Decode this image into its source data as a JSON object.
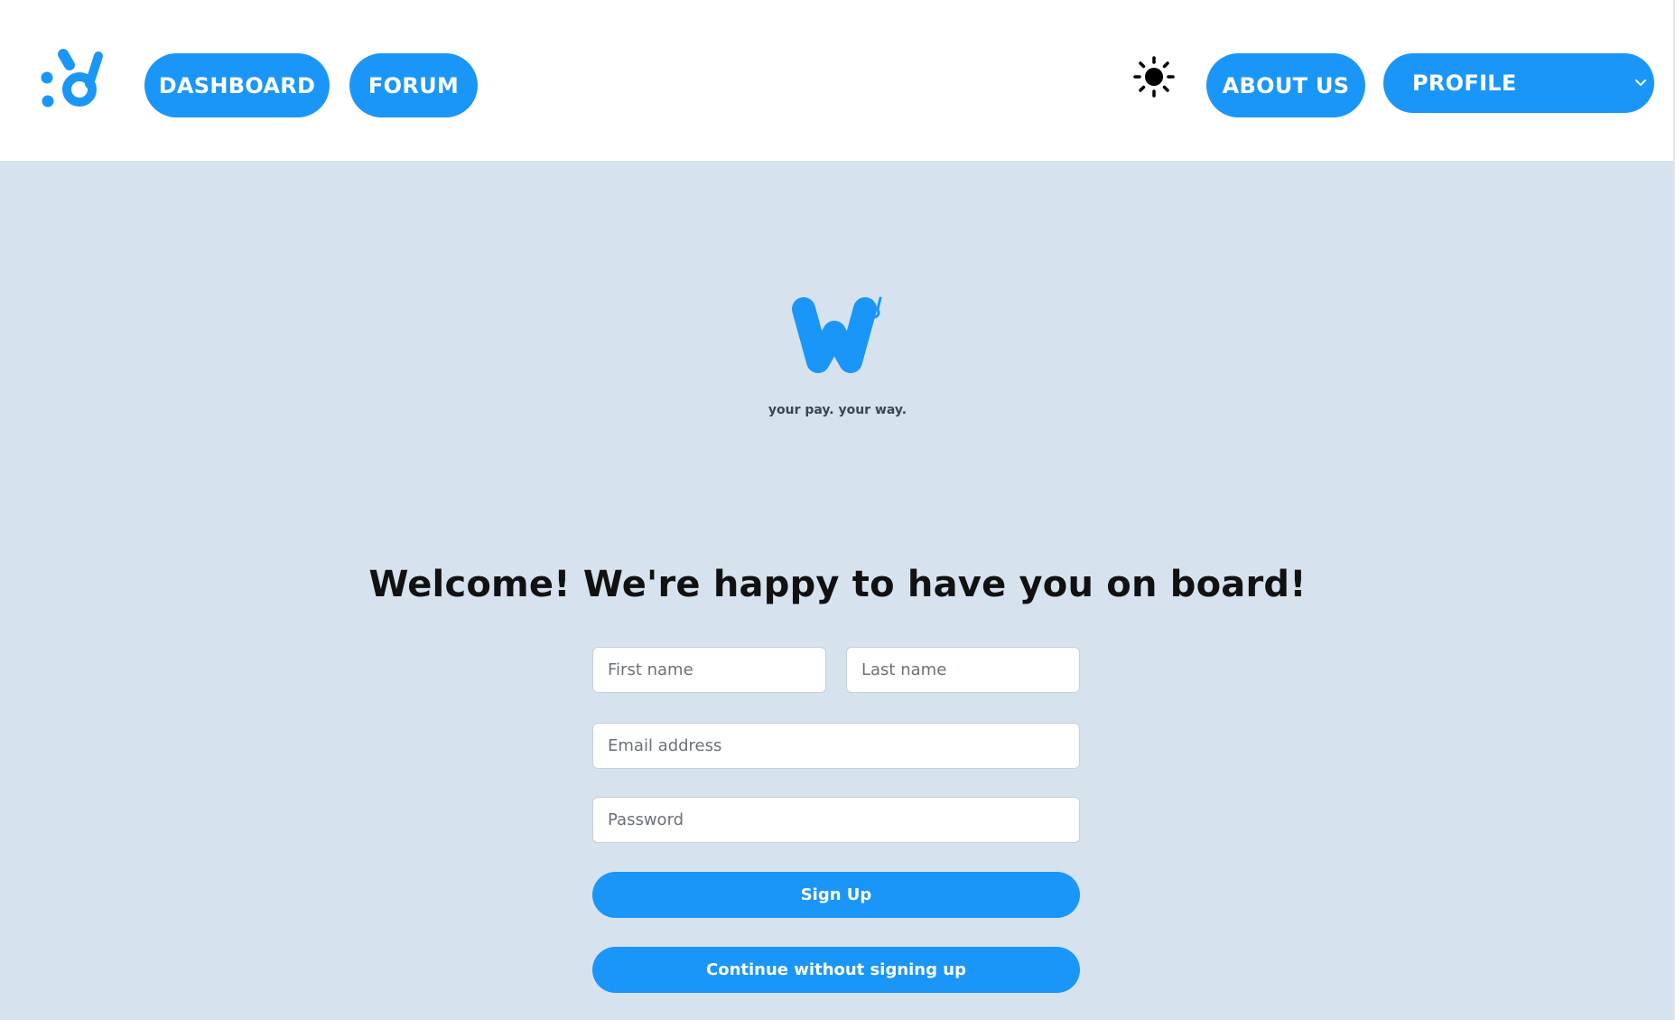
{
  "nav": {
    "logo_icon": "brand-logo-icon",
    "dashboard_label": "DASHBOARD",
    "forum_label": "FORUM",
    "theme_icon": "sun-icon",
    "about_label": "ABOUT US",
    "profile_label": "PROFILE",
    "profile_icon": "chevron-down-icon"
  },
  "hero": {
    "brand_icon": "w-brand-icon",
    "tagline": "your pay. your way."
  },
  "signup": {
    "heading": "Welcome! We're happy to have you on board!",
    "first_name_placeholder": "First name",
    "last_name_placeholder": "Last name",
    "email_placeholder": "Email address",
    "password_placeholder": "Password",
    "signup_label": "Sign Up",
    "continue_label": "Continue without signing up"
  },
  "colors": {
    "accent": "#1a96f8",
    "background": "#d6e3ef",
    "header_background": "#ffffff"
  }
}
